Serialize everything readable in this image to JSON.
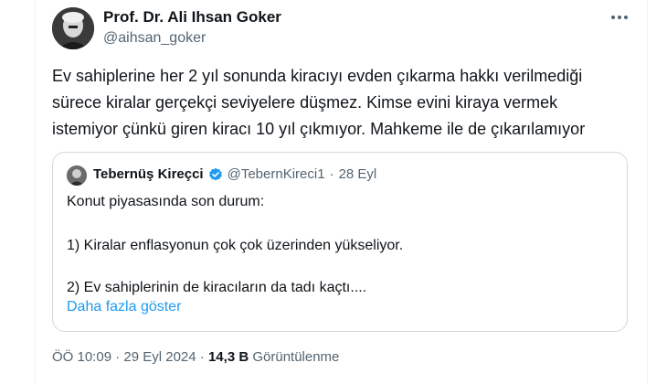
{
  "author": {
    "name": "Prof. Dr. Ali Ihsan Goker",
    "handle": "@aihsan_goker"
  },
  "tweet": {
    "lines": [
      "Ev sahiplerine her 2 yıl sonunda kiracıyı evden çıkarma hakkı verilmediği",
      "sürece kiralar gerçekçi seviyelere düşmez. Kimse evini kiraya vermek",
      "istemiyor çünkü giren kiracı 10 yıl çıkmıyor. Mahkeme ile de çıkarılamıyor"
    ]
  },
  "quoted": {
    "name": "Tebernüş Kireçci",
    "handle": "@TebernKireci1",
    "date": "28 Eyl",
    "separator": "·",
    "lines": [
      "Konut piyasasında son durum:",
      "1) Kiralar enflasyonun çok çok üzerinden yükseliyor.",
      "2) Ev sahiplerinin de kiracıların da tadı kaçtı...."
    ],
    "show_more": "Daha fazla göster",
    "verified_color": "#1d9bf0"
  },
  "meta": {
    "time": "ÖÖ 10:09",
    "separator1": "·",
    "date": "29 Eyl 2024",
    "separator2": "·",
    "views_count": "14,3 B",
    "views_label": "Görüntülenme"
  },
  "icons": {
    "more": "more-horizontal-icon",
    "verified": "verified-badge-icon"
  }
}
